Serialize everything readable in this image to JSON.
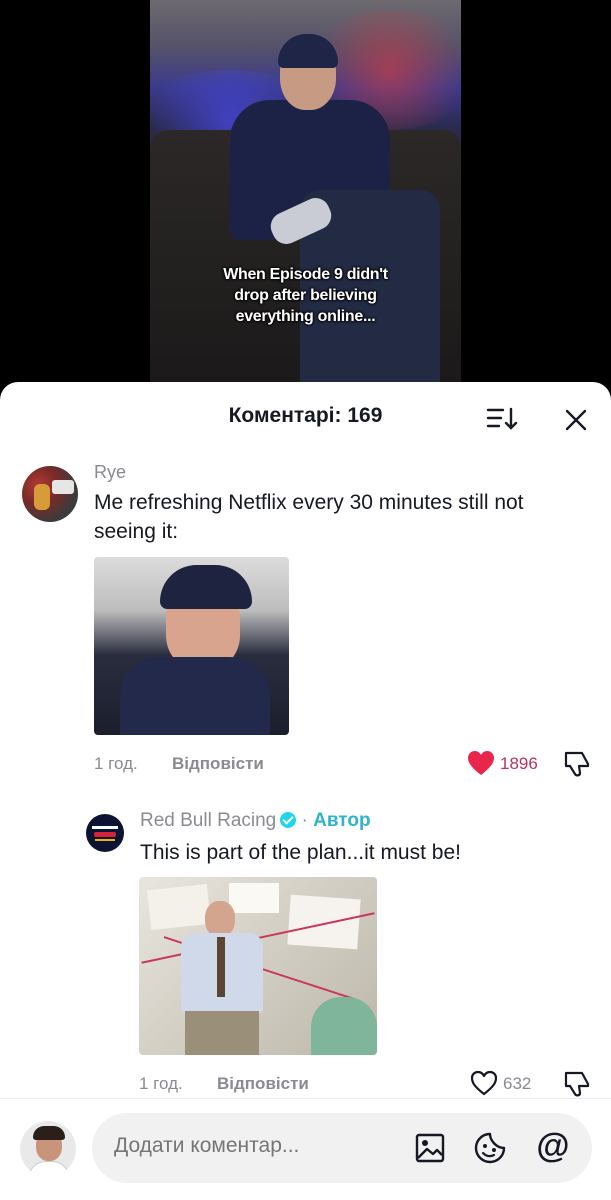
{
  "video": {
    "caption_lines": [
      "When Episode 9 didn't",
      "drop after believing",
      "everything online..."
    ]
  },
  "comments_panel": {
    "title": "Коментарі: 169",
    "sort_icon": "sort-icon",
    "close_icon": "close-icon"
  },
  "comments": [
    {
      "username": "Rye",
      "text": "Me refreshing Netflix every 30 minutes still not seeing it:",
      "time": "1 год.",
      "reply_label": "Відповісти",
      "likes": "1896",
      "liked": true
    },
    {
      "username": "Red Bull Racing",
      "author_label": "Автор",
      "separator": "·",
      "text": "This is part of the plan...it must be!",
      "time": "1 год.",
      "reply_label": "Відповісти",
      "likes": "632",
      "liked": false
    }
  ],
  "composer": {
    "placeholder": "Додати коментар...",
    "icons": [
      "image-icon",
      "emoji-icon",
      "mention-icon"
    ],
    "mention_symbol": "@"
  },
  "colors": {
    "like_active": "#e8264b",
    "verified": "#20d5ec",
    "author_tag": "#2fb4c9",
    "muted_text": "#8a8b91"
  }
}
